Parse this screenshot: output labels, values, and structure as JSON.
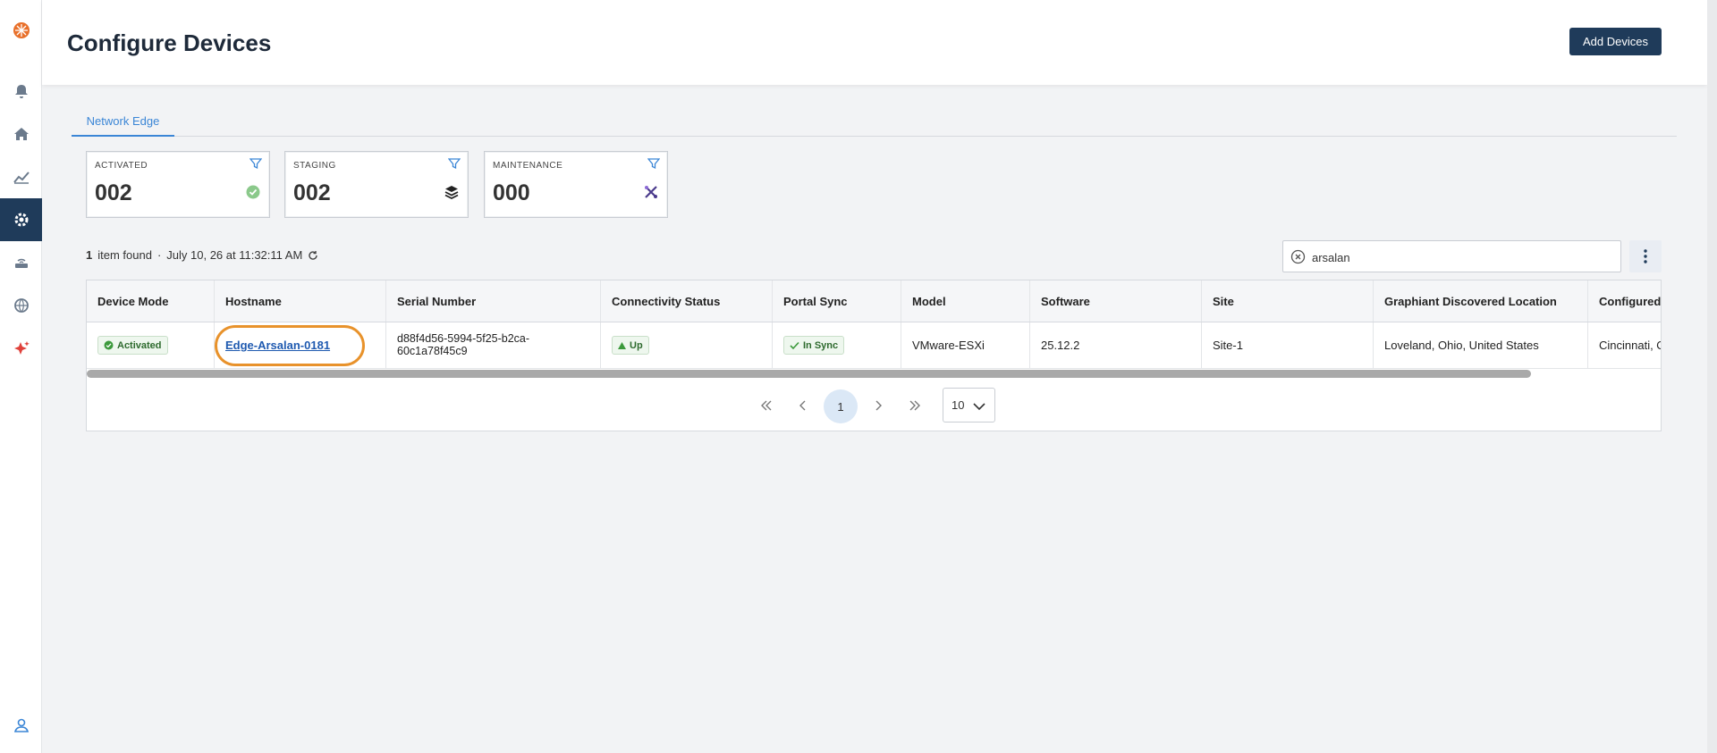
{
  "header": {
    "title": "Configure Devices",
    "add_button": "Add Devices"
  },
  "tabs": [
    {
      "label": "Network Edge",
      "active": true
    }
  ],
  "stats": [
    {
      "label": "ACTIVATED",
      "value": "002",
      "icon": "check-circle-icon"
    },
    {
      "label": "STAGING",
      "value": "002",
      "icon": "layers-icon"
    },
    {
      "label": "MAINTENANCE",
      "value": "000",
      "icon": "tools-icon"
    }
  ],
  "results": {
    "count": "1",
    "text": "item found",
    "timestamp": "July 10, 26 at 11:32:11 AM"
  },
  "search": {
    "value": "arsalan"
  },
  "table": {
    "columns": [
      "Device Mode",
      "Hostname",
      "Serial Number",
      "Connectivity Status",
      "Portal Sync",
      "Model",
      "Software",
      "Site",
      "Graphiant Discovered Location",
      "Configured"
    ],
    "rows": [
      {
        "device_mode": "Activated",
        "hostname": "Edge-Arsalan-0181",
        "serial_line1": "d88f4d56-5994-5f25-b2ca-",
        "serial_line2": "60c1a78f45c9",
        "connectivity": "Up",
        "portal_sync": "In Sync",
        "model": "VMware-ESXi",
        "software": "25.12.2",
        "site": "Site-1",
        "discovered_location": "Loveland, Ohio, United States",
        "configured": "Cincinnati, O"
      }
    ]
  },
  "pagination": {
    "current_page": "1",
    "page_size": "10"
  },
  "colors": {
    "accent": "#3b86d6",
    "nav_active": "#1f3b5a",
    "highlight_ring": "#e8922b",
    "success": "#2d6a2d"
  }
}
